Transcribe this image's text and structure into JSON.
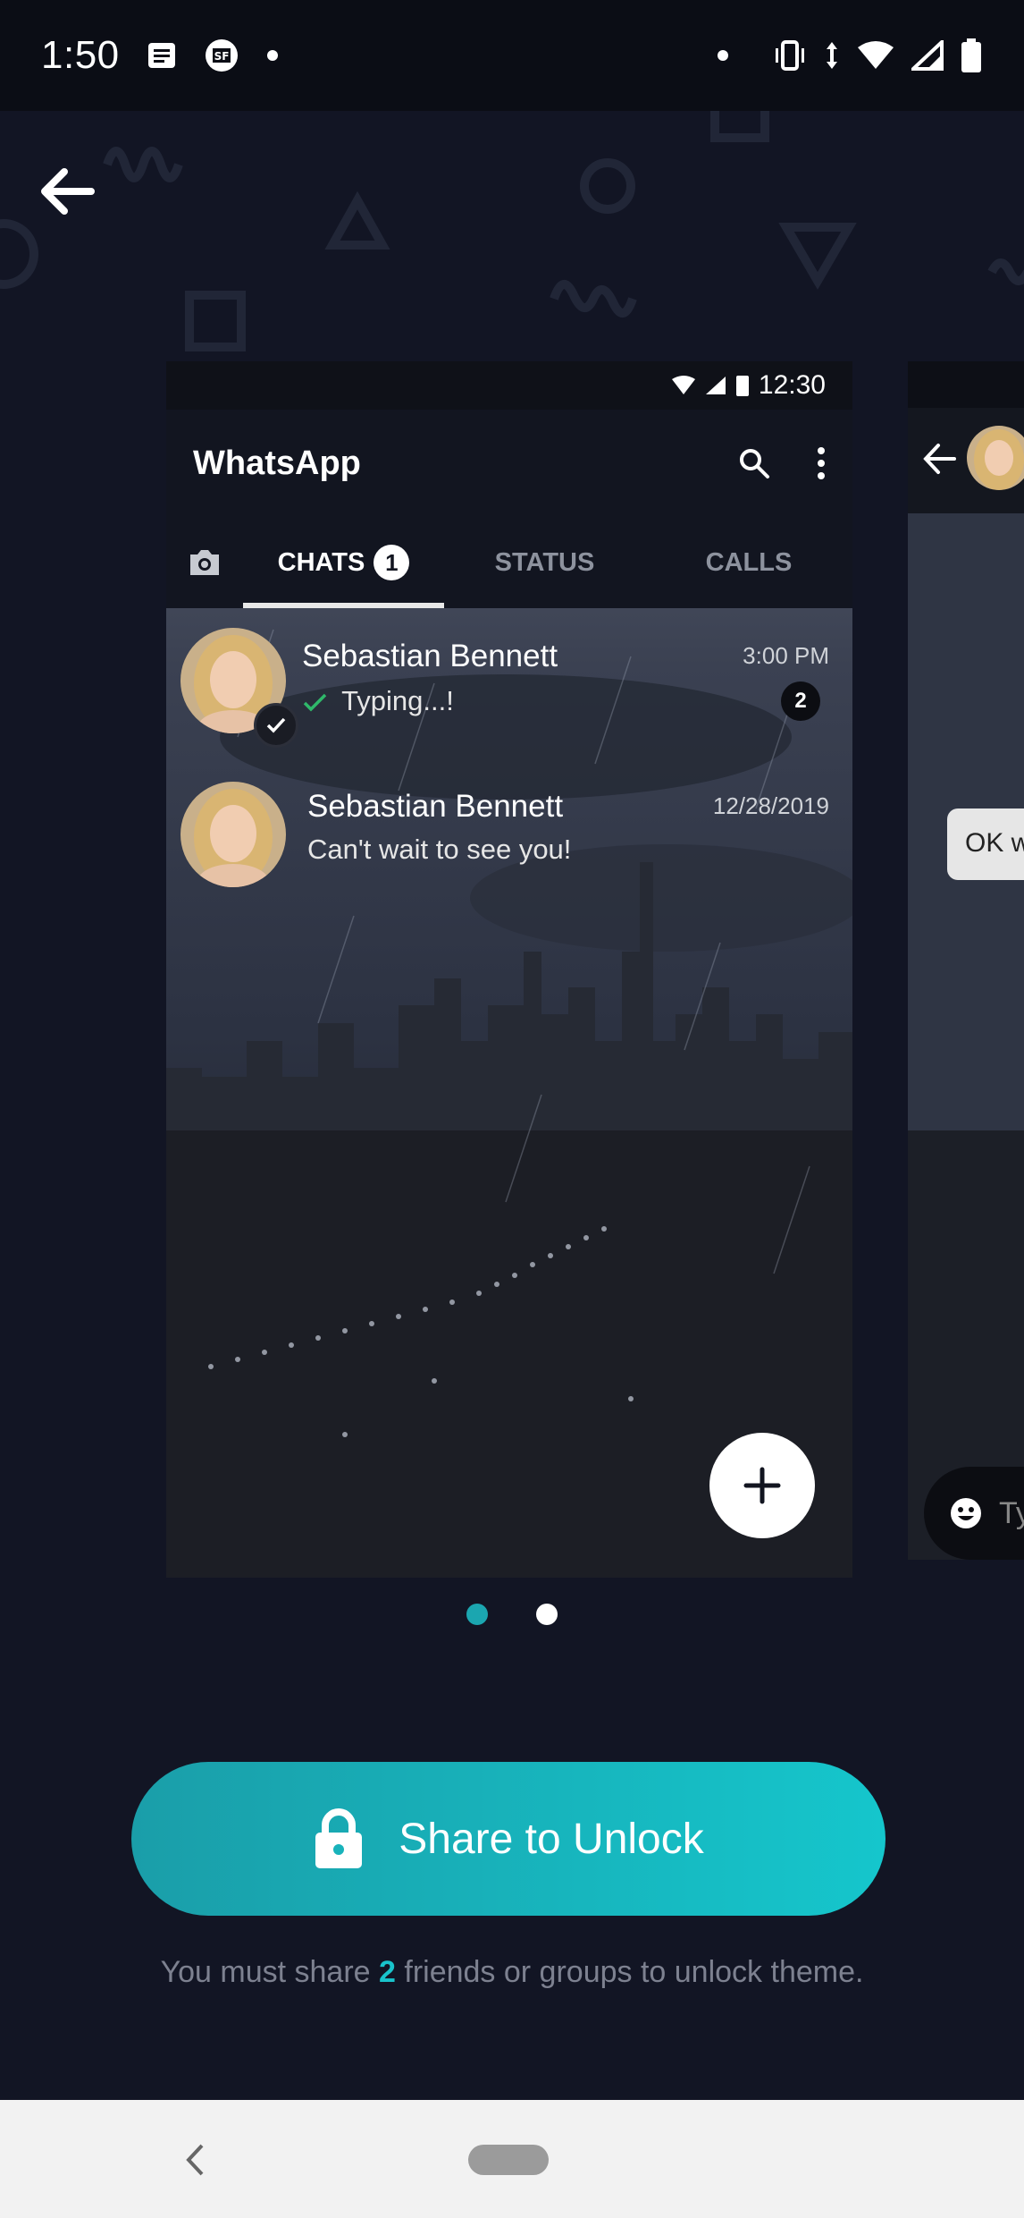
{
  "status_bar": {
    "time": "1:50",
    "icons": [
      "notes-icon",
      "sf-app-icon",
      "dot-icon",
      "dot-icon",
      "vibrate-icon",
      "data-arrows-icon",
      "wifi-icon",
      "signal-icon",
      "battery-icon"
    ]
  },
  "header": {
    "back_icon": "arrow-left-icon"
  },
  "preview": {
    "status_time": "12:30",
    "app_title": "WhatsApp",
    "tabs": [
      {
        "label": "CHATS",
        "badge": "1"
      },
      {
        "label": "STATUS"
      },
      {
        "label": "CALLS"
      }
    ],
    "chats": [
      {
        "name": "Sebastian Bennett",
        "message": "Typing...!",
        "time": "3:00 PM",
        "unread": "2"
      },
      {
        "name": "Sebastian Bennett",
        "message": "Can't wait to see you!",
        "time": "12/28/2019"
      }
    ]
  },
  "peek": {
    "bubble_text": "OK w",
    "input_text": "Ty"
  },
  "pager": {
    "count": 2,
    "active_index": 0
  },
  "share_button": {
    "label": "Share to Unlock",
    "icon": "lock-icon"
  },
  "hint": {
    "prefix": "You must share ",
    "count": "2",
    "suffix": " friends or groups to unlock theme."
  },
  "colors": {
    "accent": "#19c3cb",
    "background": "#121524",
    "nav_bar": "#f2f2f2"
  }
}
